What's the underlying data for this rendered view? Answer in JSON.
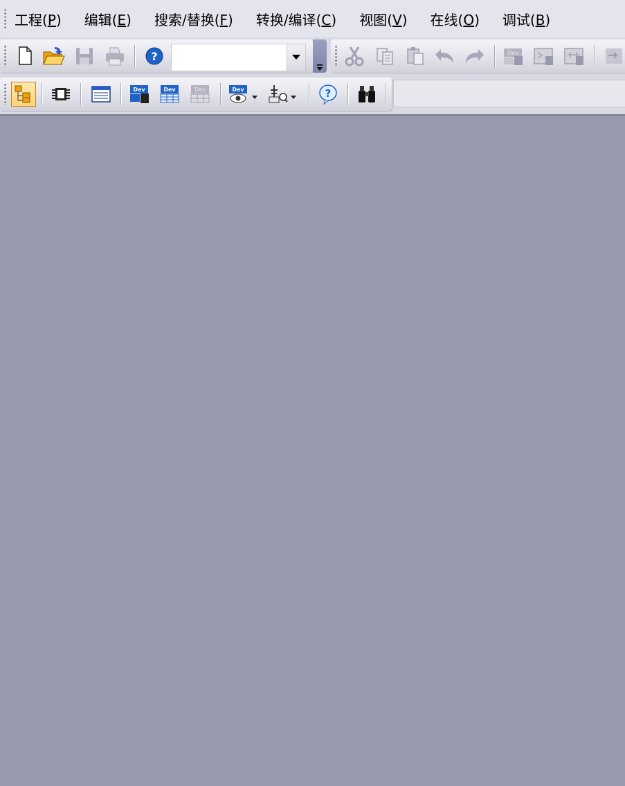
{
  "menu": [
    {
      "label": "工程",
      "key": "P"
    },
    {
      "label": "编辑",
      "key": "E"
    },
    {
      "label": "搜索/替换",
      "key": "F"
    },
    {
      "label": "转换/编译",
      "key": "C"
    },
    {
      "label": "视图",
      "key": "V"
    },
    {
      "label": "在线",
      "key": "O"
    },
    {
      "label": "调试",
      "key": "B"
    }
  ],
  "toolbar": {
    "combo_value": ""
  },
  "search": {
    "value": ""
  },
  "colors": {
    "workspace": "#9999b0",
    "toolbar_bg": "#d9d9e3",
    "active_button": "#ffd27a",
    "help_blue": "#1f62c8",
    "open_orange": "#f0a010"
  },
  "icons": {
    "row1": [
      "new-file-icon",
      "open-folder-icon",
      "save-icon",
      "print-icon",
      "help-icon",
      "cut-icon",
      "copy-icon",
      "paste-icon",
      "undo-icon",
      "redo-icon",
      "device-batch-icon",
      "device-monitor-icon",
      "device-compare-icon",
      "transfer-icon"
    ],
    "row2": [
      "project-tree-icon",
      "module-icon",
      "list-view-icon",
      "device-batch-blue-icon",
      "device-table-icon",
      "device-grey-icon",
      "device-watch-icon",
      "device-search-icon",
      "help-question-icon",
      "find-binoculars-icon"
    ]
  }
}
